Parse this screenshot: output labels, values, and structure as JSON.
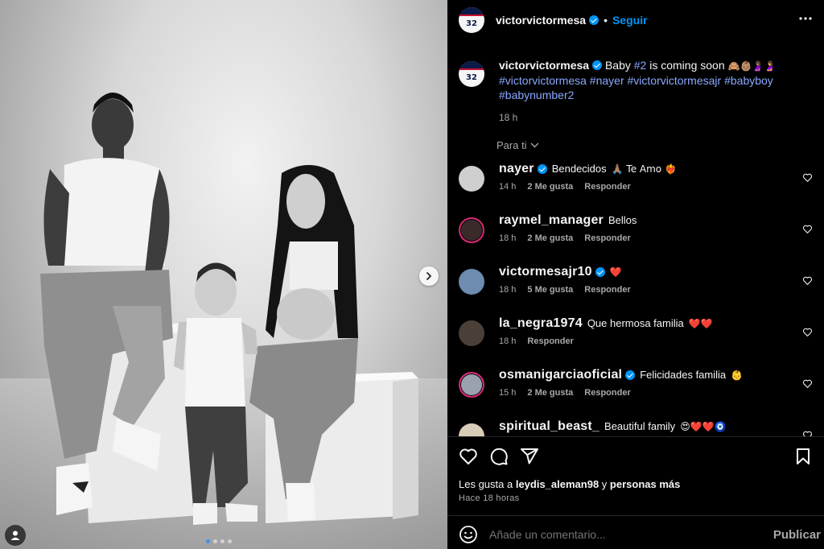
{
  "post": {
    "author": "victorvictormesa",
    "author_jersey": "32",
    "follow_label": "Seguir",
    "caption_lead": "Baby ",
    "caption_tag_num": "#2",
    "caption_rest": " is coming soon",
    "caption_emojis": "🙈👶🏽🤰🏽🤰",
    "caption_hashtags": "#victorvictormesa #nayer #victorvictormesajr #babyboy #babynumber2",
    "caption_time": "18 h",
    "sort_label": "Para ti"
  },
  "comments": [
    {
      "user": "nayer",
      "verified": true,
      "text": "Bendecidos",
      "emoji": "🙏🏽 Te Amo ❤️‍🔥",
      "time": "14 h",
      "likes": "2 Me gusta",
      "reply": "Responder"
    },
    {
      "user": "raymel_manager",
      "verified": false,
      "text": "Bellos",
      "emoji": "",
      "time": "18 h",
      "likes": "2 Me gusta",
      "reply": "Responder"
    },
    {
      "user": "victormesajr10",
      "verified": true,
      "text": "",
      "emoji": "❤️",
      "time": "18 h",
      "likes": "5 Me gusta",
      "reply": "Responder"
    },
    {
      "user": "la_negra1974",
      "verified": false,
      "text": "Que hermosa familia",
      "emoji": "❤️❤️",
      "time": "18 h",
      "likes": "",
      "reply": "Responder"
    },
    {
      "user": "osmanigarciaoficial",
      "verified": true,
      "text": "Felicidades familia",
      "emoji": "👶",
      "time": "15 h",
      "likes": "2 Me gusta",
      "reply": "Responder"
    },
    {
      "user": "spiritual_beast_",
      "verified": false,
      "text": "Beautiful family",
      "emoji": "😍❤️❤️🧿",
      "time": "",
      "likes": "",
      "reply": ""
    }
  ],
  "likes_line": {
    "prefix": "Les gusta a ",
    "user": "leydis_aleman98",
    "middle": " y ",
    "suffix": "personas más"
  },
  "posted_ago": "Hace 18 horas",
  "composer": {
    "placeholder": "Añade un comentario...",
    "publish": "Publicar"
  },
  "carousel": {
    "count": 4,
    "active": 0
  },
  "colors": {
    "accent": "#0095f6",
    "hashtag": "#8aa9ff",
    "muted": "#a8a8a8",
    "background": "#000000"
  },
  "icons": [
    "more-options-icon",
    "verified-badge-icon",
    "chevron-down-icon",
    "heart-icon",
    "comment-icon",
    "share-icon",
    "bookmark-icon",
    "emoji-icon",
    "user-tag-icon",
    "chevron-right-icon"
  ]
}
